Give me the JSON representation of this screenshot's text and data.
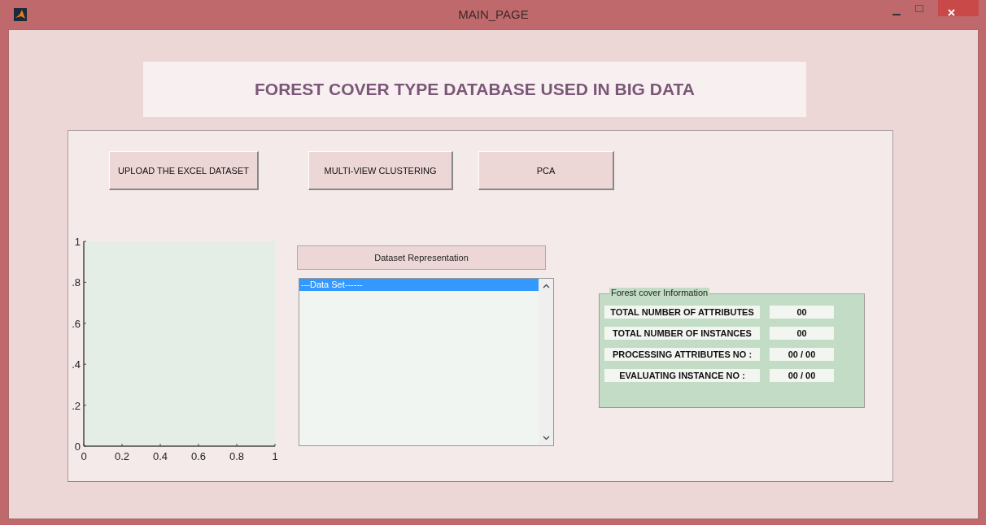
{
  "window": {
    "title": "MAIN_PAGE"
  },
  "heading": "FOREST COVER TYPE DATABASE USED IN BIG DATA",
  "buttons": [
    "UPLOAD THE EXCEL DATASET",
    "MULTI-VIEW CLUSTERING",
    "PCA"
  ],
  "plot": {
    "chart_data": {
      "type": "line",
      "xlim": [
        0,
        1
      ],
      "ylim": [
        0,
        1
      ],
      "xticks": [
        0,
        0.2,
        0.4,
        0.6,
        0.8,
        1
      ],
      "yticks": [
        0,
        {
          "value": 0.2,
          "label": ".2"
        },
        {
          "value": 0.4,
          "label": ".4"
        },
        {
          "value": 0.6,
          "label": ".6"
        },
        {
          "value": 0.8,
          "label": ".8"
        },
        1
      ]
    }
  },
  "dataset_label": "Dataset Representation",
  "listbox": {
    "items": [
      {
        "text": "---Data Set------",
        "selected": true
      }
    ]
  },
  "info_group": {
    "title": "Forest cover Information",
    "rows": [
      {
        "label": "TOTAL NUMBER OF ATTRIBUTES",
        "value": "00"
      },
      {
        "label": "TOTAL NUMBER OF INSTANCES",
        "value": "00"
      },
      {
        "label": "PROCESSING ATTRIBUTES NO :",
        "value": "00 / 00"
      },
      {
        "label": "EVALUATING INSTANCE  NO :",
        "value": "00 / 00"
      }
    ]
  }
}
